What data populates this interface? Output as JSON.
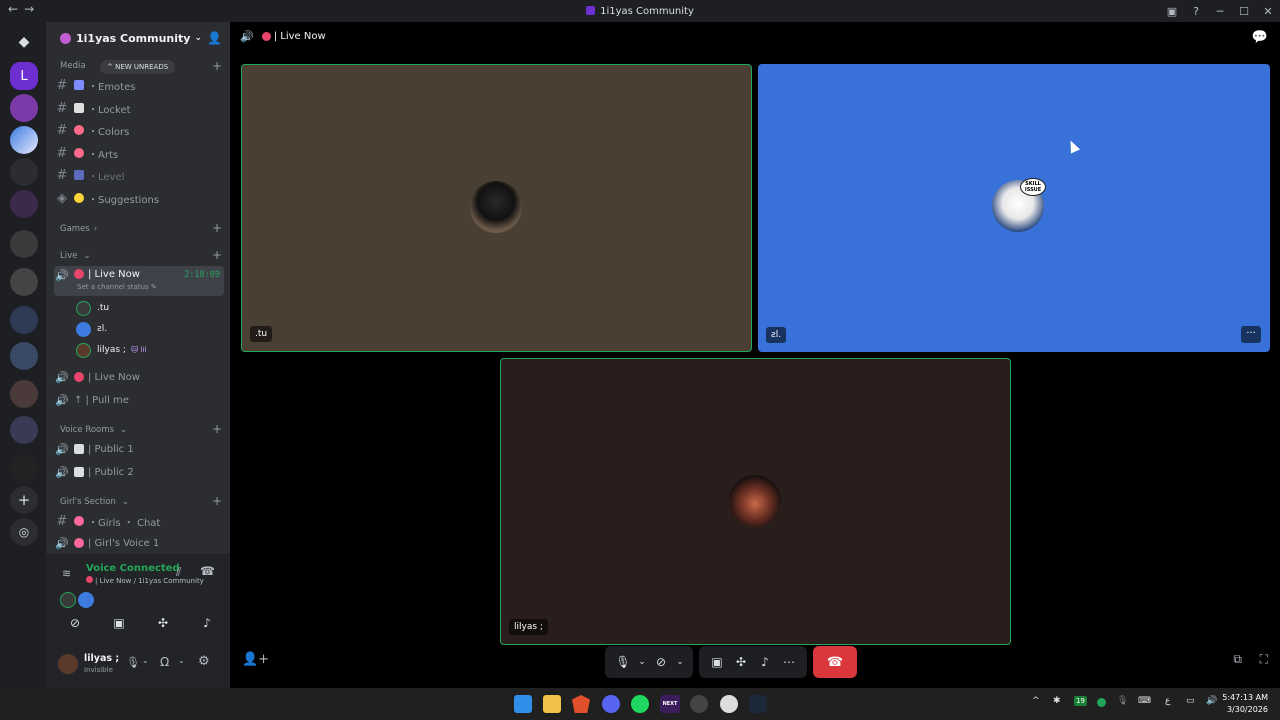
{
  "window": {
    "title": "1i1yas Community",
    "nav_back": "←",
    "nav_forward": "→",
    "controls": [
      "▣",
      "?",
      "─",
      "☐",
      "✕"
    ]
  },
  "server": {
    "name": "1i1yas Community",
    "new_unreads": "NEW UNREADS"
  },
  "channels": {
    "media_category": "Media",
    "media_items": [
      {
        "label": "・Emotes",
        "color": "#7c8cff"
      },
      {
        "label": "・Locket",
        "color": "#e0e0e0"
      },
      {
        "label": "・Colors",
        "color": "#ff6a8a"
      },
      {
        "label": "・Arts",
        "color": "#ff6a8a"
      },
      {
        "label": "・Level",
        "color": "#5c6bc0"
      },
      {
        "label": "・Suggestions",
        "color": "#ffd43b"
      }
    ],
    "games_category": "Games",
    "live_category": "Live",
    "live_now": "| Live Now",
    "live_timer": "2:18:09",
    "live_status": "Set a channel status",
    "members": [
      {
        "name": ".tu",
        "color": "#3a3a3a"
      },
      {
        "name": "ƨl.",
        "color": "#3d7be0"
      },
      {
        "name": "lilyas ;",
        "color": "#5a3a2a",
        "badge": "🐱 lil"
      }
    ],
    "live_now_2": "| Live Now",
    "pull_me": "↑ | Pull me",
    "voice_rooms_category": "Voice Rooms",
    "public_1": "| Public 1",
    "public_2": "| Public 2",
    "girls_category": "Girl's Section",
    "girls_chat": "・Girls ・ Chat",
    "girls_voice": "| Girl's Voice 1"
  },
  "voice": {
    "status": "Voice Connected",
    "location": "| Live Now / 1i1yas Community"
  },
  "user": {
    "name": "lilyas ;",
    "status": "Invisible"
  },
  "stage": {
    "channel": "| Live Now",
    "tiles": [
      {
        "name": ".tu",
        "bg": "#4a3f33"
      },
      {
        "name": "ƨl.",
        "bg": "#3872d8"
      },
      {
        "name": "lilyas ;",
        "bg": "#2a1e1c"
      }
    ],
    "tile_menu": "···",
    "skill_badge": "SKILL ISSUE"
  },
  "taskbar": {
    "time": "5:47:13 AM",
    "date": "3/30/2026",
    "tray_badge": "19",
    "lang": "ع",
    "mdi_next": "NEXT"
  }
}
